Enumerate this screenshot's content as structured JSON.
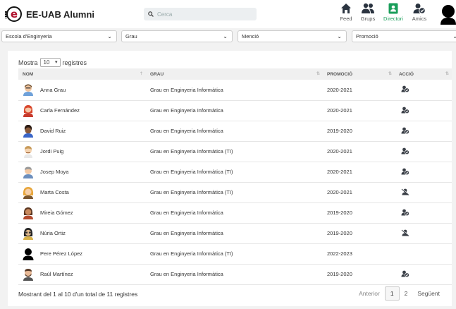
{
  "app": {
    "title": "EE-UAB Alumni",
    "logo_letter": "e"
  },
  "search": {
    "placeholder": "Cerca"
  },
  "nav": [
    {
      "label": "Feed",
      "icon": "home-icon"
    },
    {
      "label": "Grups",
      "icon": "group-icon"
    },
    {
      "label": "Directori",
      "icon": "directory-icon",
      "active": true
    },
    {
      "label": "Amics",
      "icon": "friends-icon"
    }
  ],
  "filters": {
    "escola": "Escola d'Enginyeria",
    "grau": "Grau",
    "mencio": "Menció",
    "promocio": "Promoció"
  },
  "table": {
    "show_prefix": "Mostra",
    "show_value": "10",
    "show_suffix": "registres",
    "columns": [
      "NOM",
      "GRAU",
      "PROMOCIÓ",
      "ACCIÓ"
    ],
    "rows": [
      {
        "name": "Anna Grau",
        "grau": "Grau en Enginyeria Informàtica",
        "promocio": "2020-2021",
        "action": "add-friend-icon",
        "avatar": "avatar-bald-man"
      },
      {
        "name": "Carla Fernández",
        "grau": "Grau en Enginyeria Informàtica",
        "promocio": "2020-2021",
        "action": "add-friend-icon",
        "avatar": "avatar-red-hair"
      },
      {
        "name": "David Ruiz",
        "grau": "Grau en Enginyeria Informàtica",
        "promocio": "2019-2020",
        "action": "add-friend-icon",
        "avatar": "avatar-dark-curly"
      },
      {
        "name": "Jordi Puig",
        "grau": "Grau en Enginyeria Informàtica (TI)",
        "promocio": "2020-2021",
        "action": "add-friend-icon",
        "avatar": "avatar-man-light"
      },
      {
        "name": "Josep Moya",
        "grau": "Grau en Enginyeria Informàtica (TI)",
        "promocio": "2020-2021",
        "action": "add-friend-icon",
        "avatar": "avatar-man-grey"
      },
      {
        "name": "Marta Costa",
        "grau": "Grau en Enginyeria Informàtica (TI)",
        "promocio": "2020-2021",
        "action": "remove-friend-icon",
        "avatar": "avatar-blonde"
      },
      {
        "name": "Mireia Gómez",
        "grau": "Grau en Enginyeria Informàtica",
        "promocio": "2019-2020",
        "action": "add-friend-icon",
        "avatar": "avatar-brown-hair"
      },
      {
        "name": "Núria Ortiz",
        "grau": "Grau en Enginyeria Informàtica",
        "promocio": "2019-2020",
        "action": "remove-friend-icon",
        "avatar": "avatar-glasses"
      },
      {
        "name": "Pere Pérez López",
        "grau": "Grau en Enginyeria Informàtica (TI)",
        "promocio": "2022-2023",
        "action": "",
        "avatar": "avatar-silhouette"
      },
      {
        "name": "Raúl Martínez",
        "grau": "Grau en Enginyeria Informàtica",
        "promocio": "2019-2020",
        "action": "add-friend-icon",
        "avatar": "avatar-bearded"
      }
    ]
  },
  "footer": {
    "info": "Mostrant del 1 al 10 d'un total de 11 registres",
    "prev": "Anterior",
    "pages": [
      "1",
      "2"
    ],
    "next": "Següent"
  },
  "colors": {
    "accent": "#1a9e5a",
    "brand": "#b0122d"
  }
}
